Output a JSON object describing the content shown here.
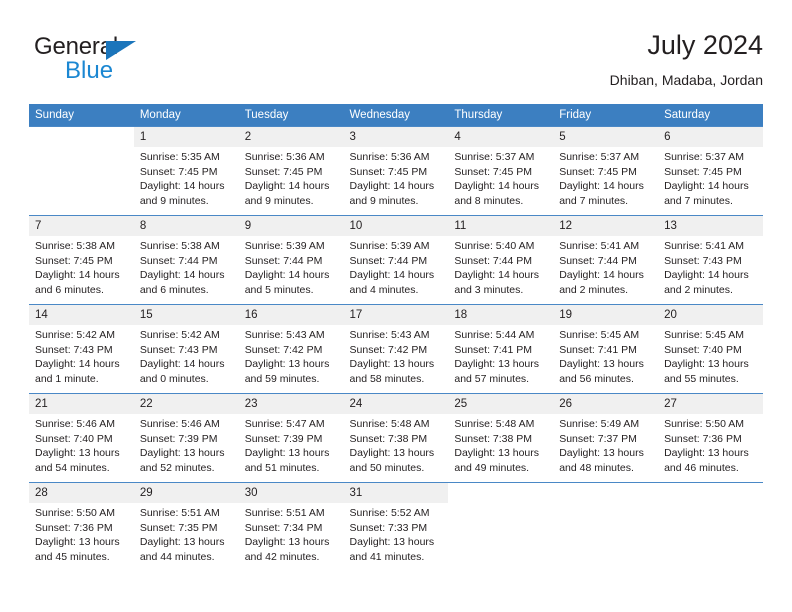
{
  "brand": {
    "name_top": "General",
    "name_bottom": "Blue",
    "accent_color": "#1b75bb",
    "accent_color_light": "#1b87d2"
  },
  "header": {
    "title": "July 2024",
    "subtitle": "Dhiban, Madaba, Jordan"
  },
  "calendar": {
    "header_bg": "#3c7fc1",
    "daynum_bg": "#f0f0f0",
    "rule_color": "#4a88c6",
    "weekday_headers": [
      "Sunday",
      "Monday",
      "Tuesday",
      "Wednesday",
      "Thursday",
      "Friday",
      "Saturday"
    ],
    "weeks": [
      [
        {
          "day": "",
          "lines": []
        },
        {
          "day": "1",
          "lines": [
            "Sunrise: 5:35 AM",
            "Sunset: 7:45 PM",
            "Daylight: 14 hours",
            "and 9 minutes."
          ]
        },
        {
          "day": "2",
          "lines": [
            "Sunrise: 5:36 AM",
            "Sunset: 7:45 PM",
            "Daylight: 14 hours",
            "and 9 minutes."
          ]
        },
        {
          "day": "3",
          "lines": [
            "Sunrise: 5:36 AM",
            "Sunset: 7:45 PM",
            "Daylight: 14 hours",
            "and 9 minutes."
          ]
        },
        {
          "day": "4",
          "lines": [
            "Sunrise: 5:37 AM",
            "Sunset: 7:45 PM",
            "Daylight: 14 hours",
            "and 8 minutes."
          ]
        },
        {
          "day": "5",
          "lines": [
            "Sunrise: 5:37 AM",
            "Sunset: 7:45 PM",
            "Daylight: 14 hours",
            "and 7 minutes."
          ]
        },
        {
          "day": "6",
          "lines": [
            "Sunrise: 5:37 AM",
            "Sunset: 7:45 PM",
            "Daylight: 14 hours",
            "and 7 minutes."
          ]
        }
      ],
      [
        {
          "day": "7",
          "lines": [
            "Sunrise: 5:38 AM",
            "Sunset: 7:45 PM",
            "Daylight: 14 hours",
            "and 6 minutes."
          ]
        },
        {
          "day": "8",
          "lines": [
            "Sunrise: 5:38 AM",
            "Sunset: 7:44 PM",
            "Daylight: 14 hours",
            "and 6 minutes."
          ]
        },
        {
          "day": "9",
          "lines": [
            "Sunrise: 5:39 AM",
            "Sunset: 7:44 PM",
            "Daylight: 14 hours",
            "and 5 minutes."
          ]
        },
        {
          "day": "10",
          "lines": [
            "Sunrise: 5:39 AM",
            "Sunset: 7:44 PM",
            "Daylight: 14 hours",
            "and 4 minutes."
          ]
        },
        {
          "day": "11",
          "lines": [
            "Sunrise: 5:40 AM",
            "Sunset: 7:44 PM",
            "Daylight: 14 hours",
            "and 3 minutes."
          ]
        },
        {
          "day": "12",
          "lines": [
            "Sunrise: 5:41 AM",
            "Sunset: 7:44 PM",
            "Daylight: 14 hours",
            "and 2 minutes."
          ]
        },
        {
          "day": "13",
          "lines": [
            "Sunrise: 5:41 AM",
            "Sunset: 7:43 PM",
            "Daylight: 14 hours",
            "and 2 minutes."
          ]
        }
      ],
      [
        {
          "day": "14",
          "lines": [
            "Sunrise: 5:42 AM",
            "Sunset: 7:43 PM",
            "Daylight: 14 hours",
            "and 1 minute."
          ]
        },
        {
          "day": "15",
          "lines": [
            "Sunrise: 5:42 AM",
            "Sunset: 7:43 PM",
            "Daylight: 14 hours",
            "and 0 minutes."
          ]
        },
        {
          "day": "16",
          "lines": [
            "Sunrise: 5:43 AM",
            "Sunset: 7:42 PM",
            "Daylight: 13 hours",
            "and 59 minutes."
          ]
        },
        {
          "day": "17",
          "lines": [
            "Sunrise: 5:43 AM",
            "Sunset: 7:42 PM",
            "Daylight: 13 hours",
            "and 58 minutes."
          ]
        },
        {
          "day": "18",
          "lines": [
            "Sunrise: 5:44 AM",
            "Sunset: 7:41 PM",
            "Daylight: 13 hours",
            "and 57 minutes."
          ]
        },
        {
          "day": "19",
          "lines": [
            "Sunrise: 5:45 AM",
            "Sunset: 7:41 PM",
            "Daylight: 13 hours",
            "and 56 minutes."
          ]
        },
        {
          "day": "20",
          "lines": [
            "Sunrise: 5:45 AM",
            "Sunset: 7:40 PM",
            "Daylight: 13 hours",
            "and 55 minutes."
          ]
        }
      ],
      [
        {
          "day": "21",
          "lines": [
            "Sunrise: 5:46 AM",
            "Sunset: 7:40 PM",
            "Daylight: 13 hours",
            "and 54 minutes."
          ]
        },
        {
          "day": "22",
          "lines": [
            "Sunrise: 5:46 AM",
            "Sunset: 7:39 PM",
            "Daylight: 13 hours",
            "and 52 minutes."
          ]
        },
        {
          "day": "23",
          "lines": [
            "Sunrise: 5:47 AM",
            "Sunset: 7:39 PM",
            "Daylight: 13 hours",
            "and 51 minutes."
          ]
        },
        {
          "day": "24",
          "lines": [
            "Sunrise: 5:48 AM",
            "Sunset: 7:38 PM",
            "Daylight: 13 hours",
            "and 50 minutes."
          ]
        },
        {
          "day": "25",
          "lines": [
            "Sunrise: 5:48 AM",
            "Sunset: 7:38 PM",
            "Daylight: 13 hours",
            "and 49 minutes."
          ]
        },
        {
          "day": "26",
          "lines": [
            "Sunrise: 5:49 AM",
            "Sunset: 7:37 PM",
            "Daylight: 13 hours",
            "and 48 minutes."
          ]
        },
        {
          "day": "27",
          "lines": [
            "Sunrise: 5:50 AM",
            "Sunset: 7:36 PM",
            "Daylight: 13 hours",
            "and 46 minutes."
          ]
        }
      ],
      [
        {
          "day": "28",
          "lines": [
            "Sunrise: 5:50 AM",
            "Sunset: 7:36 PM",
            "Daylight: 13 hours",
            "and 45 minutes."
          ]
        },
        {
          "day": "29",
          "lines": [
            "Sunrise: 5:51 AM",
            "Sunset: 7:35 PM",
            "Daylight: 13 hours",
            "and 44 minutes."
          ]
        },
        {
          "day": "30",
          "lines": [
            "Sunrise: 5:51 AM",
            "Sunset: 7:34 PM",
            "Daylight: 13 hours",
            "and 42 minutes."
          ]
        },
        {
          "day": "31",
          "lines": [
            "Sunrise: 5:52 AM",
            "Sunset: 7:33 PM",
            "Daylight: 13 hours",
            "and 41 minutes."
          ]
        },
        {
          "day": "",
          "lines": []
        },
        {
          "day": "",
          "lines": []
        },
        {
          "day": "",
          "lines": []
        }
      ]
    ]
  }
}
